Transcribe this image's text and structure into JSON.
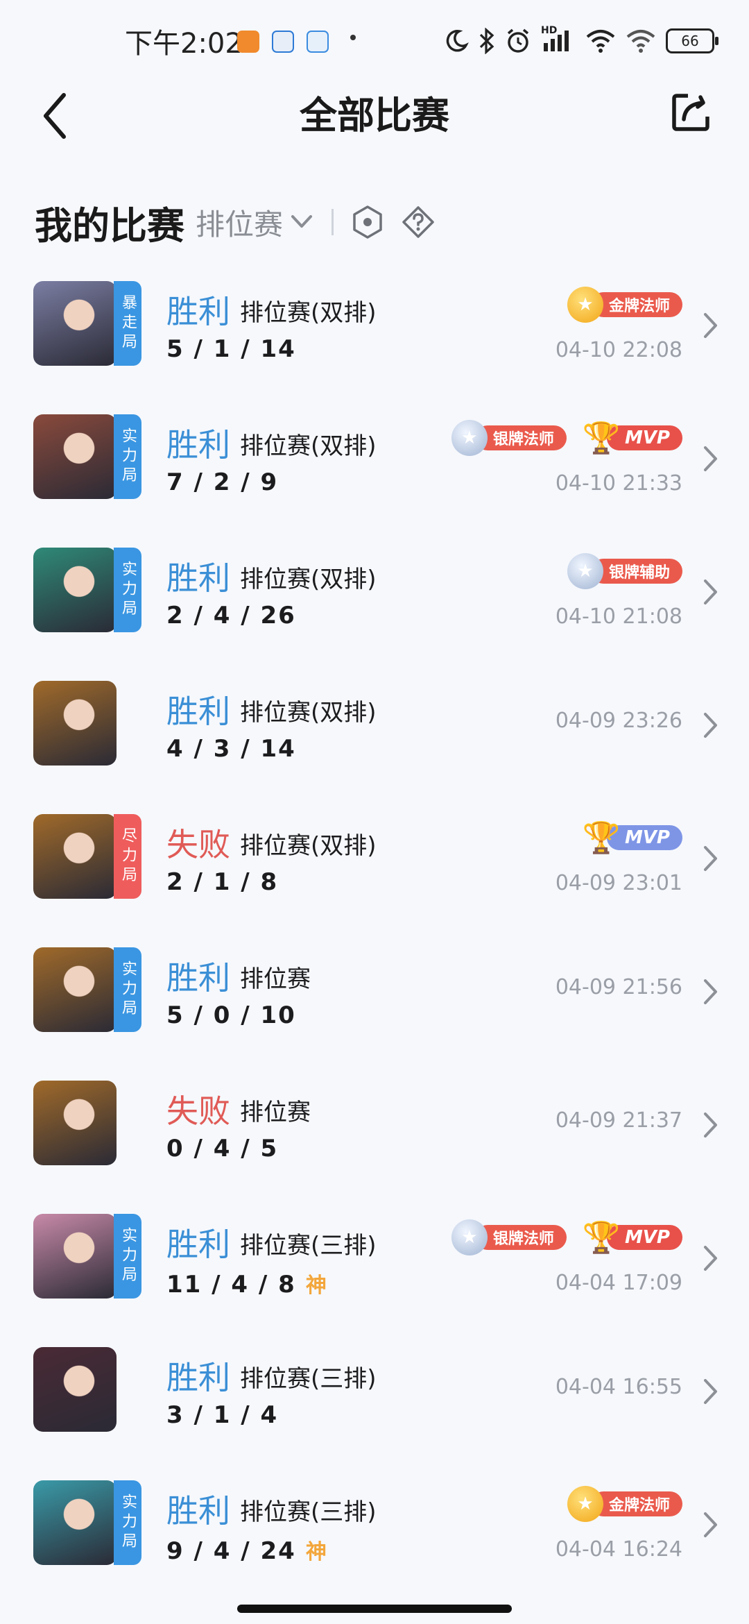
{
  "status_bar": {
    "time": "下午2:02",
    "hd_label": "HD",
    "battery": "66"
  },
  "nav": {
    "title": "全部比赛"
  },
  "section": {
    "title": "我的比赛",
    "mode": "排位赛"
  },
  "matches": [
    {
      "result": "胜利",
      "win": true,
      "type": "排位赛(双排)",
      "kda": "5 / 1 / 14",
      "shen": "",
      "time": "04-10 22:08",
      "tag": "暴走局",
      "tag_color": "blue",
      "badges": [
        {
          "kind": "gold",
          "label": "金牌法师"
        }
      ],
      "avatar_color": "#7b7ea3"
    },
    {
      "result": "胜利",
      "win": true,
      "type": "排位赛(双排)",
      "kda": "7 / 2 / 9",
      "shen": "",
      "time": "04-10 21:33",
      "tag": "实力局",
      "tag_color": "blue",
      "badges": [
        {
          "kind": "silver",
          "label": "银牌法师"
        },
        {
          "kind": "mvp-gold",
          "label": "MVP"
        }
      ],
      "avatar_color": "#8a4a3c"
    },
    {
      "result": "胜利",
      "win": true,
      "type": "排位赛(双排)",
      "kda": "2 / 4 / 26",
      "shen": "",
      "time": "04-10 21:08",
      "tag": "实力局",
      "tag_color": "blue",
      "badges": [
        {
          "kind": "silver",
          "label": "银牌辅助"
        }
      ],
      "avatar_color": "#2f8a78"
    },
    {
      "result": "胜利",
      "win": true,
      "type": "排位赛(双排)",
      "kda": "4 / 3 / 14",
      "shen": "",
      "time": "04-09 23:26",
      "tag": "",
      "tag_color": "",
      "badges": [],
      "avatar_color": "#a06a2a"
    },
    {
      "result": "失败",
      "win": false,
      "type": "排位赛(双排)",
      "kda": "2 / 1 / 8",
      "shen": "",
      "time": "04-09 23:01",
      "tag": "尽力局",
      "tag_color": "red",
      "badges": [
        {
          "kind": "mvp-blue",
          "label": "MVP"
        }
      ],
      "avatar_color": "#a06a2a"
    },
    {
      "result": "胜利",
      "win": true,
      "type": "排位赛",
      "kda": "5 / 0 / 10",
      "shen": "",
      "time": "04-09 21:56",
      "tag": "实力局",
      "tag_color": "blue",
      "badges": [],
      "avatar_color": "#a06a2a"
    },
    {
      "result": "失败",
      "win": false,
      "type": "排位赛",
      "kda": "0 / 4 / 5",
      "shen": "",
      "time": "04-09 21:37",
      "tag": "",
      "tag_color": "",
      "badges": [],
      "avatar_color": "#a06a2a"
    },
    {
      "result": "胜利",
      "win": true,
      "type": "排位赛(三排)",
      "kda": "11 / 4 / 8",
      "shen": "神",
      "time": "04-04 17:09",
      "tag": "实力局",
      "tag_color": "blue",
      "badges": [
        {
          "kind": "silver",
          "label": "银牌法师"
        },
        {
          "kind": "mvp-gold",
          "label": "MVP"
        }
      ],
      "avatar_color": "#c88aa8"
    },
    {
      "result": "胜利",
      "win": true,
      "type": "排位赛(三排)",
      "kda": "3 / 1 / 4",
      "shen": "",
      "time": "04-04 16:55",
      "tag": "",
      "tag_color": "",
      "badges": [],
      "avatar_color": "#4a2a35"
    },
    {
      "result": "胜利",
      "win": true,
      "type": "排位赛(三排)",
      "kda": "9 / 4 / 24",
      "shen": "神",
      "time": "04-04 16:24",
      "tag": "实力局",
      "tag_color": "blue",
      "badges": [
        {
          "kind": "gold",
          "label": "金牌法师"
        }
      ],
      "avatar_color": "#3a9aa8"
    }
  ]
}
